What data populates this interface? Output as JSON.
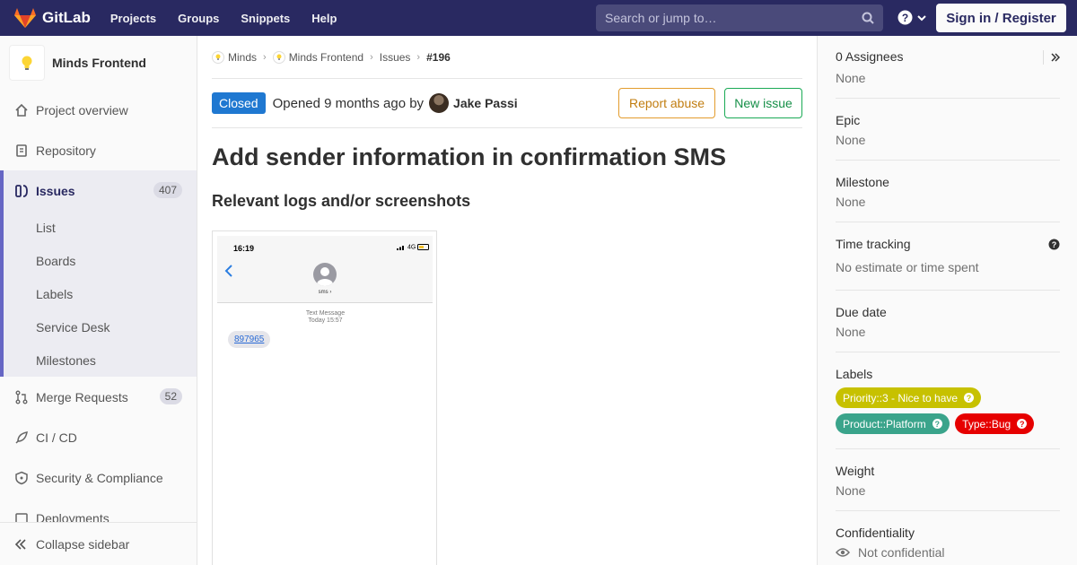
{
  "navbar": {
    "brand": "GitLab",
    "links": [
      "Projects",
      "Groups",
      "Snippets",
      "Help"
    ],
    "search_placeholder": "Search or jump to…",
    "signin_label": "Sign in / Register",
    "bg_color": "#292961"
  },
  "sidebar": {
    "project_name": "Minds Frontend",
    "items": [
      {
        "label": "Project overview",
        "icon": "home-icon"
      },
      {
        "label": "Repository",
        "icon": "doc-icon"
      },
      {
        "label": "Issues",
        "icon": "issues-icon",
        "count": "407",
        "active": true
      },
      {
        "label": "Merge Requests",
        "icon": "merge-icon",
        "count": "52"
      },
      {
        "label": "CI / CD",
        "icon": "rocket-icon"
      },
      {
        "label": "Security & Compliance",
        "icon": "shield-icon"
      },
      {
        "label": "Deployments",
        "icon": "deploy-icon"
      }
    ],
    "issue_subitems": [
      "List",
      "Boards",
      "Labels",
      "Service Desk",
      "Milestones"
    ],
    "collapse_label": "Collapse sidebar"
  },
  "breadcrumbs": [
    "Minds",
    "Minds Frontend",
    "Issues",
    "#196"
  ],
  "issue": {
    "status": "Closed",
    "opened_text": "Opened 9 months ago by",
    "author": "Jake Passi",
    "report_abuse_label": "Report abuse",
    "new_issue_label": "New issue",
    "title": "Add sender information in confirmation SMS",
    "subheading": "Relevant logs and/or screenshots"
  },
  "screenshot": {
    "time": "16:19",
    "network": "4G",
    "contact": "sms",
    "message_type": "Text Message",
    "message_time": "Today 15:57",
    "code": "897965"
  },
  "right_sidebar": {
    "assignees": {
      "title": "0 Assignees",
      "value": "None"
    },
    "epic": {
      "title": "Epic",
      "value": "None"
    },
    "milestone": {
      "title": "Milestone",
      "value": "None"
    },
    "time_tracking": {
      "title": "Time tracking",
      "value": "No estimate or time spent"
    },
    "due_date": {
      "title": "Due date",
      "value": "None"
    },
    "labels_title": "Labels",
    "labels": [
      {
        "text": "Priority::3 - Nice to have",
        "color": "#c7c100"
      },
      {
        "text": "Product::Platform",
        "color": "#3aa48b"
      },
      {
        "text": "Type::Bug",
        "color": "#e60000"
      }
    ],
    "weight": {
      "title": "Weight",
      "value": "None"
    },
    "confidentiality": {
      "title": "Confidentiality",
      "value": "Not confidential"
    }
  }
}
